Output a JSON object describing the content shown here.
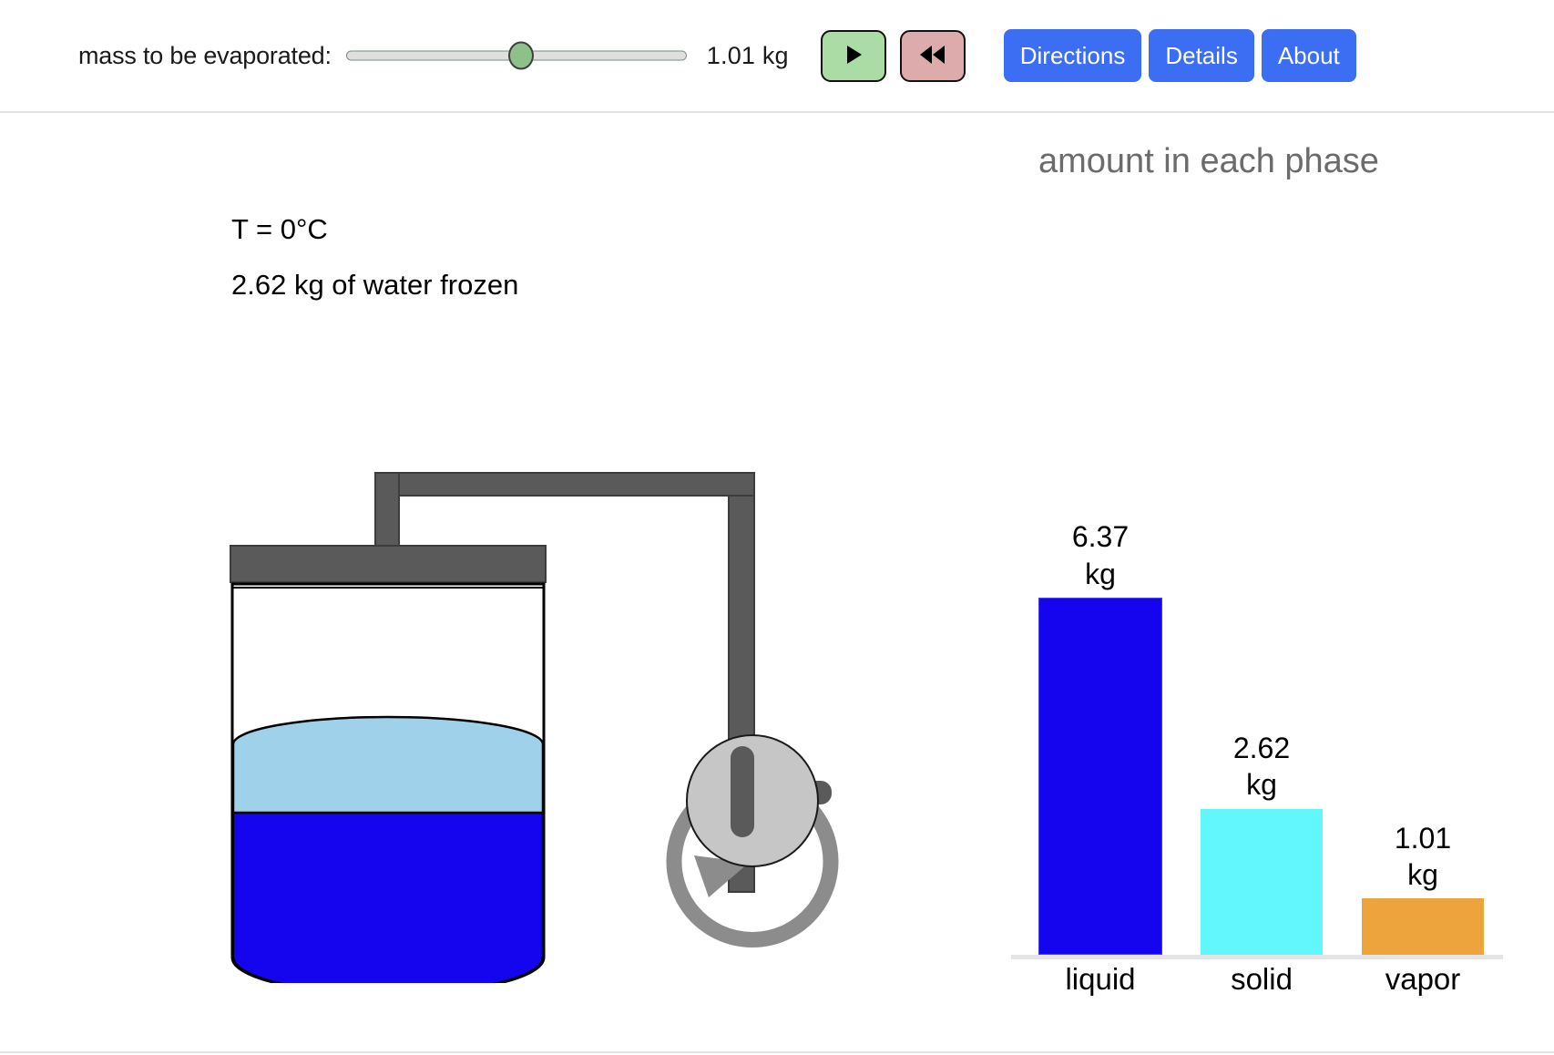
{
  "toolbar": {
    "slider_label": "mass to be evaporated:",
    "slider_value": "1.01  kg",
    "slider_min": 0,
    "slider_max": 2,
    "slider_current": 1.01,
    "play_icon": "play-triangle",
    "reset_icon": "rewind-double-triangle",
    "directions_label": "Directions",
    "details_label": "Details",
    "about_label": "About",
    "button_color": "#3b6ef3",
    "play_color": "#abdca6",
    "reset_color": "#ddabab"
  },
  "readouts": {
    "temperature": "T = 0°C",
    "frozen": "2.62 kg of water frozen"
  },
  "apparatus": {
    "container_label": "insulated-container",
    "pump_label": "vacuum-pump",
    "liquid_color": "#1405ee",
    "solid_color": "#9fd1ea",
    "pipe_color": "#5a5a5a",
    "pump_body_color": "#c6c6c6",
    "pump_arrow_color": "#8c8c8c"
  },
  "chart_data": {
    "type": "bar",
    "title": "amount in each phase",
    "categories": [
      "liquid",
      "solid",
      "vapor"
    ],
    "values": [
      6.37,
      2.62,
      1.01
    ],
    "unit": "kg",
    "value_labels": [
      "6.37\nkg",
      "2.62\nkg",
      "1.01\nkg"
    ],
    "colors": [
      "#1405ee",
      "#62f7fd",
      "#eda43c"
    ],
    "xlabel": "",
    "ylabel": "",
    "ylim": [
      0,
      7.2
    ],
    "grid": false,
    "legend": "none"
  }
}
